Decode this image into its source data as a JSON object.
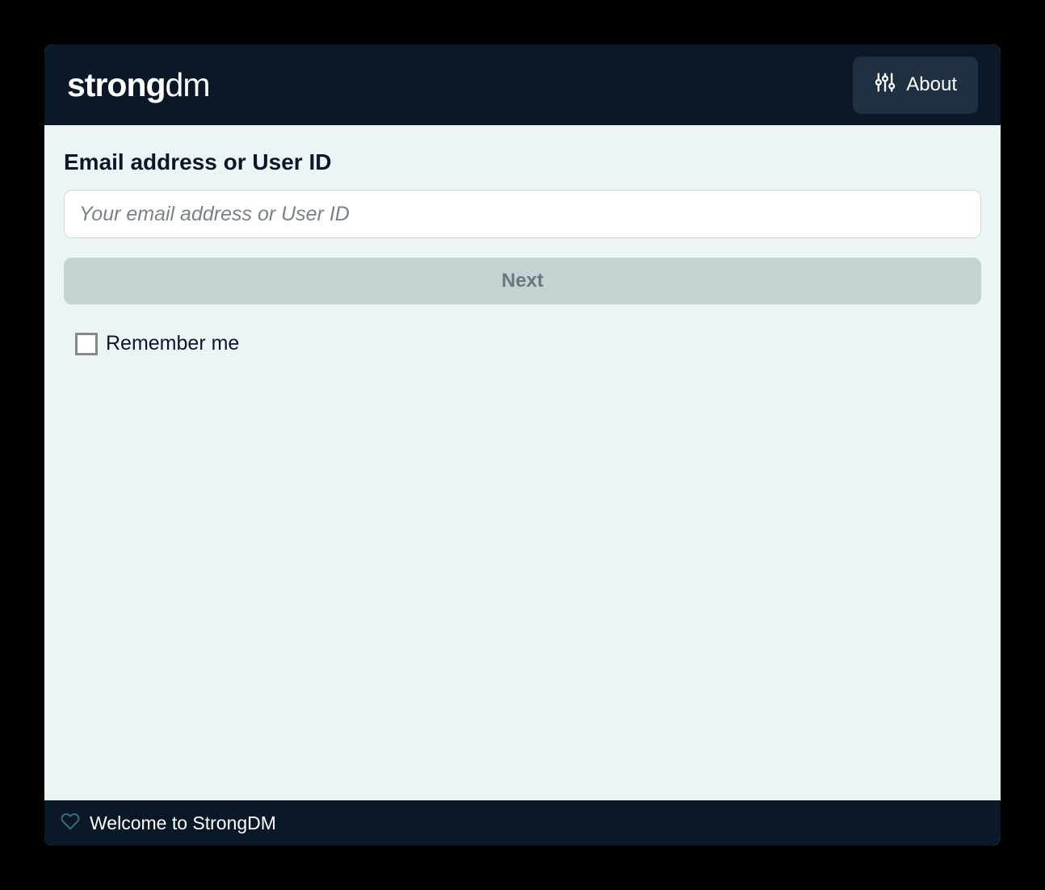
{
  "header": {
    "logo_strong": "strong",
    "logo_dm": "dm",
    "about_label": "About"
  },
  "main": {
    "email_label": "Email address or User ID",
    "email_placeholder": "Your email address or User ID",
    "email_value": "",
    "next_label": "Next",
    "remember_label": "Remember me",
    "remember_checked": false
  },
  "footer": {
    "welcome_text": "Welcome to StrongDM"
  }
}
